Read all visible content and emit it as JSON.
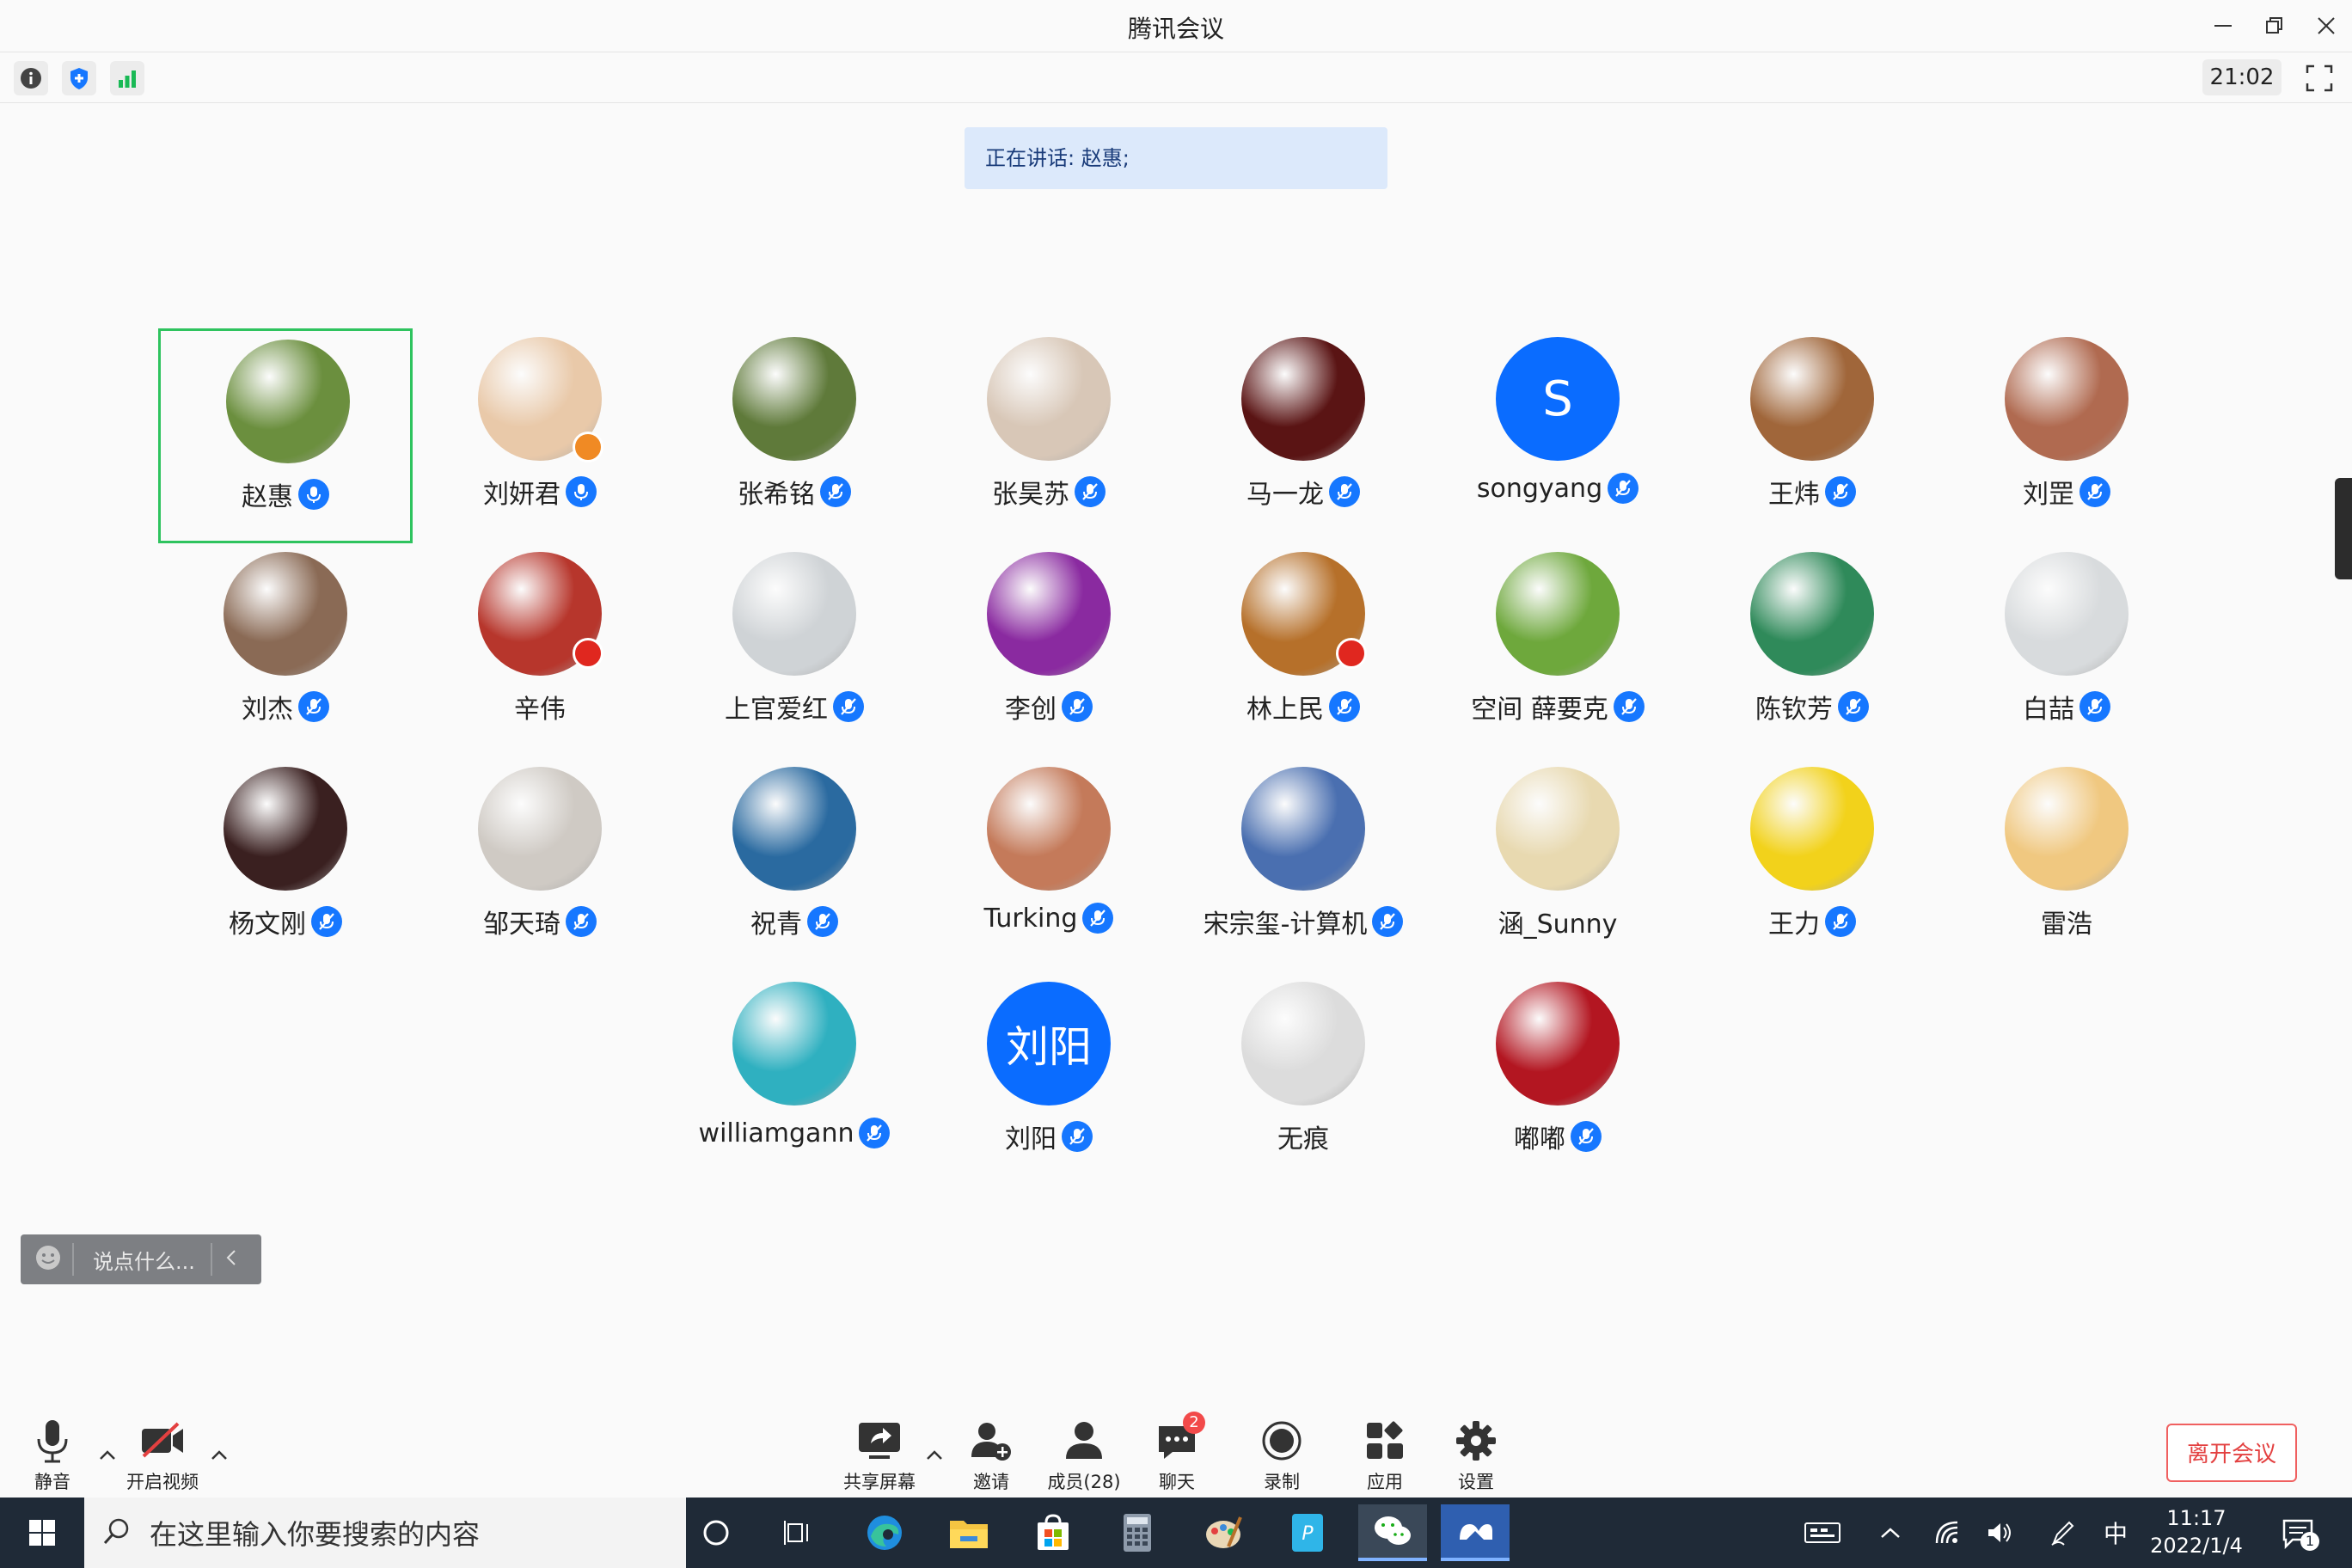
{
  "window": {
    "title": "腾讯会议",
    "minimize_icon": "minimize-icon",
    "restore_icon": "restore-icon",
    "close_icon": "close-icon"
  },
  "infobar": {
    "time": "21:02",
    "icons": [
      "info-icon",
      "shield-icon",
      "signal-bars-icon",
      "fullscreen-icon"
    ],
    "colors": {
      "shield": "#1677ff",
      "signal": "#19b955"
    }
  },
  "speaking": {
    "text": "正在讲话: 赵惠;"
  },
  "participants": [
    {
      "name": "赵惠",
      "active": true,
      "mic": "speaking",
      "avatar_color": "#6b8f3e"
    },
    {
      "name": "刘妍君",
      "mic": "speaking",
      "avatar_color": "#e9c9a9"
    },
    {
      "name": "张希铭",
      "mic": "muted",
      "avatar_color": "#5f7a3a"
    },
    {
      "name": "张昊苏",
      "mic": "muted",
      "avatar_color": "#d8c7b7"
    },
    {
      "name": "马一龙",
      "mic": "muted",
      "avatar_color": "#5a1414"
    },
    {
      "name": "songyang",
      "mic": "muted",
      "avatar_letter": "S",
      "avatar_color": "#0a6cff"
    },
    {
      "name": "王炜",
      "mic": "muted",
      "avatar_color": "#a0663a"
    },
    {
      "name": "刘罡",
      "mic": "muted",
      "avatar_color": "#b06a50"
    },
    {
      "name": "刘杰",
      "mic": "muted",
      "avatar_color": "#8a6a55"
    },
    {
      "name": "辛伟",
      "mic": "none",
      "avatar_color": "#b7362c"
    },
    {
      "name": "上官爱红",
      "mic": "muted",
      "avatar_color": "#cfd3d6"
    },
    {
      "name": "李创",
      "mic": "muted",
      "avatar_color": "#8a2aa0"
    },
    {
      "name": "林上民",
      "mic": "muted",
      "avatar_color": "#b6702a"
    },
    {
      "name": "空间 薛要克",
      "mic": "muted",
      "avatar_color": "#6ea83c"
    },
    {
      "name": "陈钦芳",
      "mic": "muted",
      "avatar_color": "#2f8a5a"
    },
    {
      "name": "白喆",
      "mic": "muted",
      "avatar_color": "#d8dbdd"
    },
    {
      "name": "杨文刚",
      "mic": "muted",
      "avatar_color": "#3a2020"
    },
    {
      "name": "邹天琦",
      "mic": "muted",
      "avatar_color": "#cfcac4"
    },
    {
      "name": "祝青",
      "mic": "muted",
      "avatar_color": "#2a6aa0"
    },
    {
      "name": "Turking",
      "mic": "muted",
      "avatar_color": "#c47a5a"
    },
    {
      "name": "宋宗玺-计算机",
      "mic": "muted",
      "avatar_color": "#4a6fb0"
    },
    {
      "name": "涵_Sunny",
      "mic": "none",
      "avatar_color": "#e8d9b0"
    },
    {
      "name": "王力",
      "mic": "muted",
      "avatar_color": "#f2d21b"
    },
    {
      "name": "雷浩",
      "mic": "none",
      "avatar_color": "#f0c880"
    },
    {
      "name": "williamgann",
      "mic": "muted",
      "avatar_color": "#2fb0c0"
    },
    {
      "name": "刘阳",
      "mic": "muted",
      "avatar_text": "刘阳",
      "avatar_color": "#0a6cff"
    },
    {
      "name": "无痕",
      "mic": "none",
      "avatar_color": "#dcdcdc"
    },
    {
      "name": "嘟嘟",
      "mic": "muted",
      "avatar_color": "#b31621"
    }
  ],
  "chat_input": {
    "placeholder": "说点什么..."
  },
  "toolbar": {
    "mute": "静音",
    "video": "开启视频",
    "share": "共享屏幕",
    "invite": "邀请",
    "members": "成员(28)",
    "chat": "聊天",
    "chat_badge": "2",
    "record": "录制",
    "apps": "应用",
    "settings": "设置",
    "leave": "离开会议"
  },
  "taskbar": {
    "search_placeholder": "在这里输入你要搜索的内容",
    "ime": "中",
    "time": "11:17",
    "date": "2022/1/4",
    "notification_count": "1"
  }
}
